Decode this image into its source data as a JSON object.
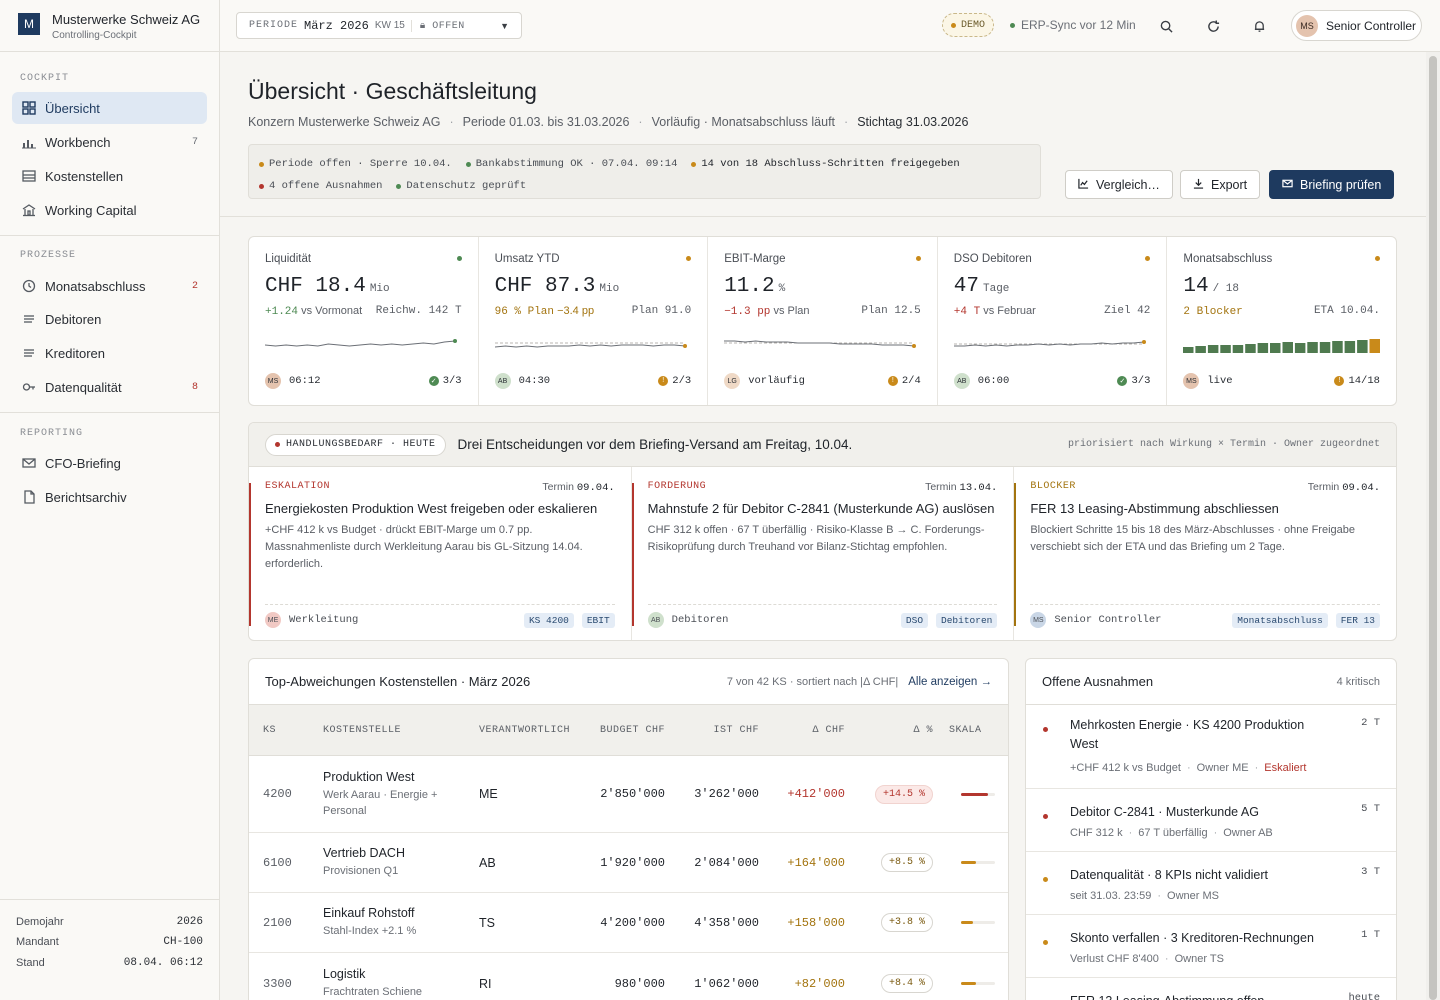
{
  "sidebar": {
    "brand": {
      "logo": "M",
      "name": "Musterwerke Schweiz AG",
      "sub": "Controlling-Cockpit"
    },
    "sections": [
      {
        "label": "COCKPIT",
        "items": [
          {
            "label": "Übersicht",
            "icon": "grid-icon",
            "count": "",
            "active": true
          },
          {
            "label": "Workbench",
            "icon": "bar-chart-icon",
            "count": "7"
          },
          {
            "label": "Kostenstellen",
            "icon": "table-icon",
            "count": ""
          },
          {
            "label": "Working Capital",
            "icon": "bank-icon",
            "count": ""
          }
        ]
      },
      {
        "label": "PROZESSE",
        "items": [
          {
            "label": "Monatsabschluss",
            "icon": "clock-icon",
            "count": "2"
          },
          {
            "label": "Debitoren",
            "icon": "list-icon",
            "count": ""
          },
          {
            "label": "Kreditoren",
            "icon": "list-icon",
            "count": ""
          },
          {
            "label": "Datenqualität",
            "icon": "key-icon",
            "count": "8"
          }
        ]
      },
      {
        "label": "REPORTING",
        "items": [
          {
            "label": "CFO-Briefing",
            "icon": "mail-icon",
            "count": ""
          },
          {
            "label": "Berichtsarchiv",
            "icon": "document-icon",
            "count": ""
          }
        ]
      }
    ],
    "footer": [
      {
        "label": "Demojahr",
        "value": "2026"
      },
      {
        "label": "Mandant",
        "value": "CH-100"
      },
      {
        "label": "Stand",
        "value": "08.04. 06:12"
      }
    ]
  },
  "topbar": {
    "period_label": "PERIODE",
    "period_value": "März 2026",
    "period_kw": "KW 15",
    "period_status": "OFFEN",
    "demo": "DEMO",
    "erp": "ERP-Sync vor 12 Min",
    "user_initials": "MS",
    "user_name": "Senior Controller"
  },
  "header": {
    "title": "Übersicht · Geschäftsleitung",
    "sub": [
      "Konzern Musterwerke Schweiz AG",
      "Periode 01.03. bis 31.03.2026",
      "Vorläufig · Monatsabschluss läuft",
      "Stichtag 31.03.2026"
    ],
    "status_row1": [
      {
        "text": "Periode offen · Sperre 10.04.",
        "color": "amber"
      },
      {
        "text": "Bankabstimmung OK · 07.04. 09:14",
        "color": "green"
      },
      {
        "text": "14 von 18 Abschluss-Schritten freigegeben",
        "color": "amber"
      }
    ],
    "status_row2": [
      {
        "text": "4 offene Ausnahmen",
        "color": "red"
      },
      {
        "text": "Datenschutz geprüft",
        "color": "green"
      }
    ],
    "buttons": {
      "compare": "Vergleich…",
      "export": "Export",
      "briefing": "Briefing prüfen"
    }
  },
  "kpis": [
    {
      "title": "Liquidität",
      "value": "CHF 18.4",
      "unit": "Mio",
      "delta": "+1.24",
      "delta_text": "vs Vormonat",
      "right": "Reichw. 142 T",
      "owner": "MS",
      "time": "06:12",
      "check": "3/3",
      "status": "green",
      "spark": [
        16,
        17,
        16,
        17,
        16,
        17,
        15,
        16,
        17,
        16,
        15,
        16,
        15,
        16,
        15,
        14,
        15,
        13,
        12
      ],
      "last": "green"
    },
    {
      "title": "Umsatz YTD",
      "value": "CHF 87.3",
      "unit": "Mio",
      "delta": "96 % Plan",
      "delta_text": "−3.4 pp",
      "right": "Plan 91.0",
      "owner": "AB",
      "time": "04:30",
      "check": "2/3",
      "status": "amber",
      "spark": [
        18,
        17,
        18,
        17,
        18,
        17,
        17,
        17,
        16,
        17,
        16,
        17,
        16,
        16,
        16,
        17,
        16,
        16,
        17
      ],
      "last": "amber"
    },
    {
      "title": "EBIT-Marge",
      "value": "11.2",
      "unit": "%",
      "delta": "−1.3 pp",
      "delta_text": "vs Plan",
      "right": "Plan 12.5",
      "owner": "LG",
      "time": "vorläufig",
      "check": "2/4",
      "status": "amber",
      "spark": [
        12,
        12,
        13,
        12,
        13,
        13,
        13,
        14,
        14,
        14,
        14,
        15,
        15,
        15,
        15,
        16,
        16,
        16,
        17
      ],
      "last": "amber"
    },
    {
      "title": "DSO Debitoren",
      "value": "47",
      "unit": "Tage",
      "delta": "+4 T",
      "delta_text": "vs Februar",
      "right": "Ziel 42",
      "owner": "AB",
      "time": "06:00",
      "check": "3/3",
      "status": "amber",
      "spark": [
        17,
        17,
        16,
        17,
        16,
        17,
        16,
        16,
        15,
        16,
        15,
        16,
        15,
        15,
        14,
        15,
        14,
        14,
        13
      ],
      "last": "amber"
    },
    {
      "title": "Monatsabschluss",
      "value": "14",
      "unit": "/ 18",
      "delta": "2 Blocker",
      "delta_text": "",
      "right": "ETA 10.04.",
      "owner": "MS",
      "time": "live",
      "check": "14/18",
      "status": "amber",
      "bars": [
        6,
        7,
        8,
        8,
        8,
        9,
        10,
        10,
        11,
        10,
        11,
        11,
        12,
        12,
        13,
        14
      ]
    }
  ],
  "action": {
    "badge": "HANDLUNGSBEDARF · HEUTE",
    "title": "Drei Entscheidungen vor dem Briefing-Versand am Freitag, 10.04.",
    "meta": "priorisiert nach Wirkung × Termin · Owner zugeordnet",
    "due_label": "Termin",
    "cards": [
      {
        "kind": "ESKALATION",
        "kind_color": "#b3362e",
        "due": "09.04.",
        "title": "Energiekosten Produktion West freigeben oder eskalieren",
        "desc": "+CHF 412 k vs Budget · drückt EBIT-Marge um 0.7 pp. Massnahmenliste durch Werkleitung Aarau bis GL-Sitzung 14.04. erforderlich.",
        "owner_initials": "ME",
        "owner_bg": "#f1c9c4",
        "owner": "Werkleitung",
        "tags": [
          "KS 4200",
          "EBIT"
        ]
      },
      {
        "kind": "FORDERUNG",
        "kind_color": "#b3362e",
        "due": "13.04.",
        "title": "Mahnstufe 2 für Debitor C-2841 (Musterkunde AG) auslösen",
        "desc": "CHF 312 k offen · 67 T überfällig · Risiko-Klasse B → C. Forderungs-Risikoprüfung durch Treuhand vor Bilanz-Stichtag empfohlen.",
        "owner_initials": "AB",
        "owner_bg": "#cfe0cc",
        "owner": "Debitoren",
        "tags": [
          "DSO",
          "Debitoren"
        ]
      },
      {
        "kind": "BLOCKER",
        "kind_color": "#a3740f",
        "due": "09.04.",
        "title": "FER 13 Leasing-Abstimmung abschliessen",
        "desc": "Blockiert Schritte 15 bis 18 des März-Abschlusses · ohne Freigabe verschiebt sich der ETA und das Briefing um 2 Tage.",
        "owner_initials": "MS",
        "owner_bg": "#c9d6e6",
        "owner": "Senior Controller",
        "tags": [
          "Monatsabschluss",
          "FER 13"
        ]
      }
    ]
  },
  "table": {
    "title": "Top-Abweichungen Kostenstellen · März 2026",
    "meta": "7 von 42 KS · sortiert nach |Δ CHF|",
    "link": "Alle anzeigen →",
    "headers": [
      "KS",
      "KOSTENSTELLE",
      "VERANTWORTLICH",
      "BUDGET CHF",
      "IST CHF",
      "Δ CHF",
      "Δ %",
      "SKALA"
    ],
    "rows": [
      {
        "ks": "4200",
        "name": "Produktion West",
        "sub": "Werk Aarau · Energie + Personal",
        "owner": "ME",
        "budget": "2'850'000",
        "ist": "3'262'000",
        "delta": "+412'000",
        "pct": "+14.5 %",
        "severity": "red",
        "scale": 0.8
      },
      {
        "ks": "6100",
        "name": "Vertrieb DACH",
        "sub": "Provisionen Q1",
        "owner": "AB",
        "budget": "1'920'000",
        "ist": "2'084'000",
        "delta": "+164'000",
        "pct": "+8.5 %",
        "severity": "amber",
        "scale": 0.45
      },
      {
        "ks": "2100",
        "name": "Einkauf Rohstoff",
        "sub": "Stahl-Index +2.1 %",
        "owner": "TS",
        "budget": "4'200'000",
        "ist": "4'358'000",
        "delta": "+158'000",
        "pct": "+3.8 %",
        "severity": "amber",
        "scale": 0.35
      },
      {
        "ks": "3300",
        "name": "Logistik",
        "sub": "Frachtraten Schiene",
        "owner": "RI",
        "budget": "980'000",
        "ist": "1'062'000",
        "delta": "+82'000",
        "pct": "+8.4 %",
        "severity": "amber",
        "scale": 0.45
      }
    ]
  },
  "exceptions": {
    "title": "Offene Ausnahmen",
    "meta": "4 kritisch",
    "items": [
      {
        "title": "Mehrkosten Energie · KS 4200 Produktion West",
        "details": [
          "+CHF 412 k vs Budget",
          "Owner ME"
        ],
        "status": "Eskaliert",
        "age": "2 T",
        "color": "red"
      },
      {
        "title": "Debitor C-2841 · Musterkunde AG",
        "details": [
          "CHF 312 k",
          "67 T überfällig",
          "Owner AB"
        ],
        "status": "",
        "age": "5 T",
        "color": "red"
      },
      {
        "title": "Datenqualität · 8 KPIs nicht validiert",
        "details": [
          "seit 31.03. 23:59",
          "Owner MS"
        ],
        "status": "",
        "age": "3 T",
        "color": "amber"
      },
      {
        "title": "Skonto verfallen · 3 Kreditoren-Rechnungen",
        "details": [
          "Verlust CHF 8'400",
          "Owner TS"
        ],
        "status": "",
        "age": "1 T",
        "color": "amber"
      },
      {
        "title": "FER 13 Leasing-Abstimmung offen",
        "details": [],
        "status": "",
        "age": "heute",
        "color": "amber"
      }
    ]
  },
  "colors": {
    "accent": "#1e3a5f",
    "green": "#4e8a53",
    "amber": "#c98a1a",
    "red": "#b3362e"
  }
}
